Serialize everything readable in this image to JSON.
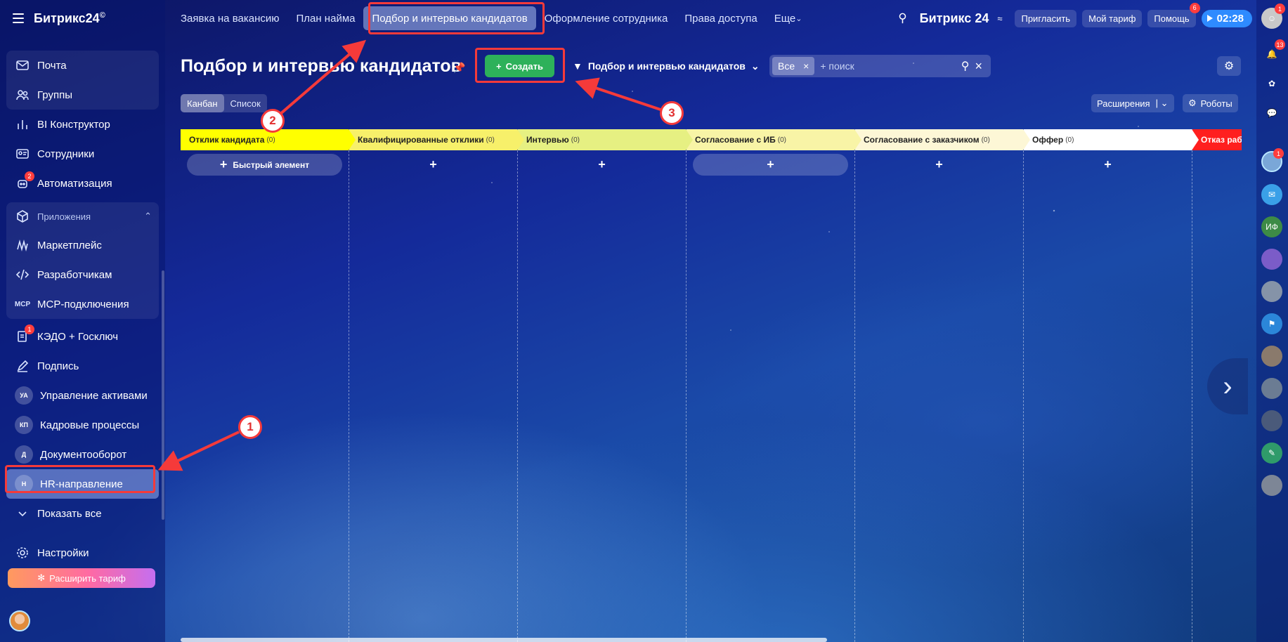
{
  "app": {
    "logo": "Битрикс24",
    "logo_mark": "©"
  },
  "sidebar": {
    "items": [
      {
        "label": "Почта",
        "icon": "mail-icon"
      },
      {
        "label": "Группы",
        "icon": "groups-icon"
      },
      {
        "label": "BI Конструктор",
        "icon": "bi-icon"
      },
      {
        "label": "Сотрудники",
        "icon": "employees-icon"
      },
      {
        "label": "Автоматизация",
        "icon": "automation-icon",
        "badge": "2"
      }
    ],
    "apps_header": "Приложения",
    "apps": [
      {
        "label": "Маркетплейс",
        "icon": "marketplace-icon"
      },
      {
        "label": "Разработчикам",
        "icon": "code-icon"
      },
      {
        "label": "MCP-подключения",
        "icon": "mcp-icon"
      }
    ],
    "more_items": [
      {
        "label": "КЭДО + Госключ",
        "badge": "1"
      },
      {
        "label": "Подпись"
      },
      {
        "label": "Управление активами",
        "initials": "УА"
      },
      {
        "label": "Кадровые процессы",
        "initials": "КП"
      },
      {
        "label": "Документооборот",
        "initials": "Д"
      },
      {
        "label": "HR-направление",
        "initials": "Н"
      }
    ],
    "show_all": "Показать все",
    "settings": "Настройки",
    "expand_tariff": "Расширить тариф"
  },
  "topbar": {
    "tabs": [
      "Заявка на вакансию",
      "План найма",
      "Подбор и интервью кандидатов",
      "Оформление сотрудника",
      "Права доступа",
      "Еще"
    ],
    "logo": "Битрикс 24",
    "invite": "Пригласить",
    "tariff": "Мой тариф",
    "help": "Помощь",
    "help_badge": "6",
    "timer": "02:28",
    "avatar_badge": "1"
  },
  "toolbar": {
    "title": "Подбор и интервью кандидатов",
    "create": "Создать",
    "filter": "Подбор и интервью кандидатов",
    "chip": "Все",
    "search_placeholder": "+ поиск",
    "view_kanban": "Канбан",
    "view_list": "Список",
    "extensions": "Расширения",
    "robots": "Роботы"
  },
  "kanban": {
    "quick_add": "Быстрый элемент",
    "columns": [
      {
        "title": "Отклик кандидата",
        "count": "(0)",
        "color": "#ffff00"
      },
      {
        "title": "Квалифицированные отклики",
        "count": "(0)",
        "color": "#f7f06a"
      },
      {
        "title": "Интервью",
        "count": "(0)",
        "color": "#e6f082"
      },
      {
        "title": "Согласование с ИБ",
        "count": "(0)",
        "color": "#f8f4a6"
      },
      {
        "title": "Согласование с заказчиком",
        "count": "(0)",
        "color": "#fdf7d6"
      },
      {
        "title": "Оффер",
        "count": "(0)",
        "color": "#ffffff"
      },
      {
        "title": "Отказ раб",
        "count": "",
        "color": "#ff1f1f"
      }
    ]
  },
  "rail": {
    "notifications_badge": "13",
    "avatar_badge": "1",
    "initials": "ИФ"
  },
  "annotations": [
    "1",
    "2",
    "3"
  ],
  "colors": {
    "accent_red": "#f53a3a",
    "create_green": "#2db15a",
    "timer_blue": "#2e8bff"
  }
}
